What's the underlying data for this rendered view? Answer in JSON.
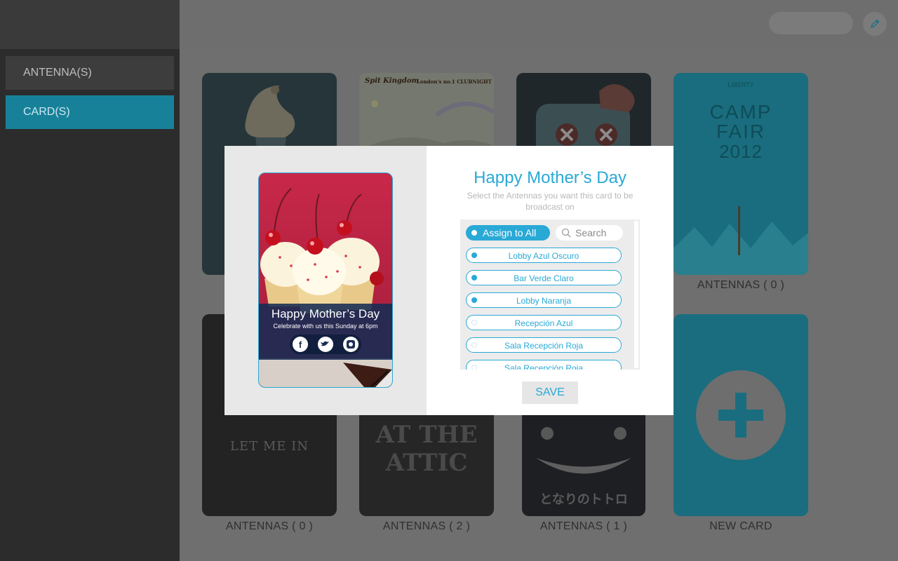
{
  "sidebar": {
    "items": [
      {
        "label": "ANTENNA(S)"
      },
      {
        "label": "CARD(S)"
      }
    ]
  },
  "cards": [
    {
      "caption": ""
    },
    {
      "caption": ""
    },
    {
      "caption": ""
    },
    {
      "caption": "ANTENNAS ( 0 )"
    },
    {
      "caption": "ANTENNAS ( 0 )",
      "poster_text": "LET ME IN"
    },
    {
      "caption": "ANTENNAS ( 2 )",
      "poster_text": "AT THE ATTIC"
    },
    {
      "caption": "ANTENNAS ( 1 )",
      "poster_text": "となりのトトロ"
    },
    {
      "caption": "NEW CARD"
    }
  ],
  "poster_texts": {
    "spit_kingdom": "Spit Kingdom",
    "spit_tagline": "London's no.1 CLUBNIGHT",
    "camp_fair_brand": "LIBERTY",
    "camp_fair_title_1": "CAMP",
    "camp_fair_title_2": "FAIR",
    "camp_fair_year": "2012"
  },
  "modal": {
    "title": "Happy Mother’s Day",
    "subtitle": "Select the Antennas you want this card to be broadcast on",
    "preview": {
      "title": "Happy Mother’s Day",
      "subtitle": "Celebrate with us this Sunday at 6pm"
    },
    "assign_all_label": "Assign to All",
    "search_placeholder": "Search",
    "antennas": [
      {
        "name": "Lobby Azul Oscuro",
        "selected": true
      },
      {
        "name": "Bar Verde Claro",
        "selected": true
      },
      {
        "name": "Lobby Naranja",
        "selected": true
      },
      {
        "name": "Recepción Azul",
        "selected": false
      },
      {
        "name": "Sala Recepción Roja",
        "selected": false
      },
      {
        "name": "Sala Recepción Roja",
        "selected": false
      }
    ],
    "save_label": "SAVE"
  },
  "colors": {
    "accent": "#29a9d6",
    "sidebar_active": "#17819a"
  }
}
